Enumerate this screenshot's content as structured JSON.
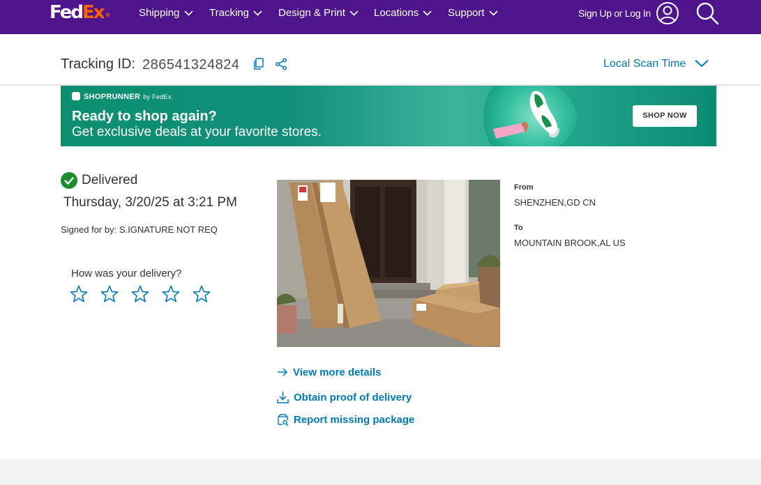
{
  "nav": {
    "logo_part1": "Fed",
    "logo_part2": "Ex",
    "logo_reg": "®",
    "items": [
      {
        "label": "Shipping"
      },
      {
        "label": "Tracking"
      },
      {
        "label": "Design & Print"
      },
      {
        "label": "Locations"
      },
      {
        "label": "Support"
      }
    ],
    "signin_label": "Sign Up or Log In",
    "colors": {
      "bar": "#4d148c",
      "logo_accent": "#ff6200"
    }
  },
  "tracking": {
    "label": "Tracking ID:",
    "id": "286541324824",
    "scan_time_label": "Local Scan Time"
  },
  "banner": {
    "brand": "SHOPRUNNER",
    "by": "by FedEx.",
    "headline": "Ready to shop again?",
    "subline": "Get exclusive deals at your favorite stores.",
    "cta": "SHOP NOW"
  },
  "status": {
    "label": "Delivered",
    "date": "Thursday, 3/20/25 at 3:21 PM",
    "signed": "Signed for by: S.IGNATURE NOT REQ",
    "rating_prompt": "How was your delivery?",
    "stars": 5,
    "color": "#1c8e2c"
  },
  "route": {
    "from_label": "From",
    "from_value": "SHENZHEN,GD CN",
    "to_label": "To",
    "to_value": "MOUNTAIN BROOK,AL US"
  },
  "links": {
    "details": "View more details",
    "proof": "Obtain proof of delivery",
    "missing": "Report missing package",
    "color": "#007ab7"
  }
}
